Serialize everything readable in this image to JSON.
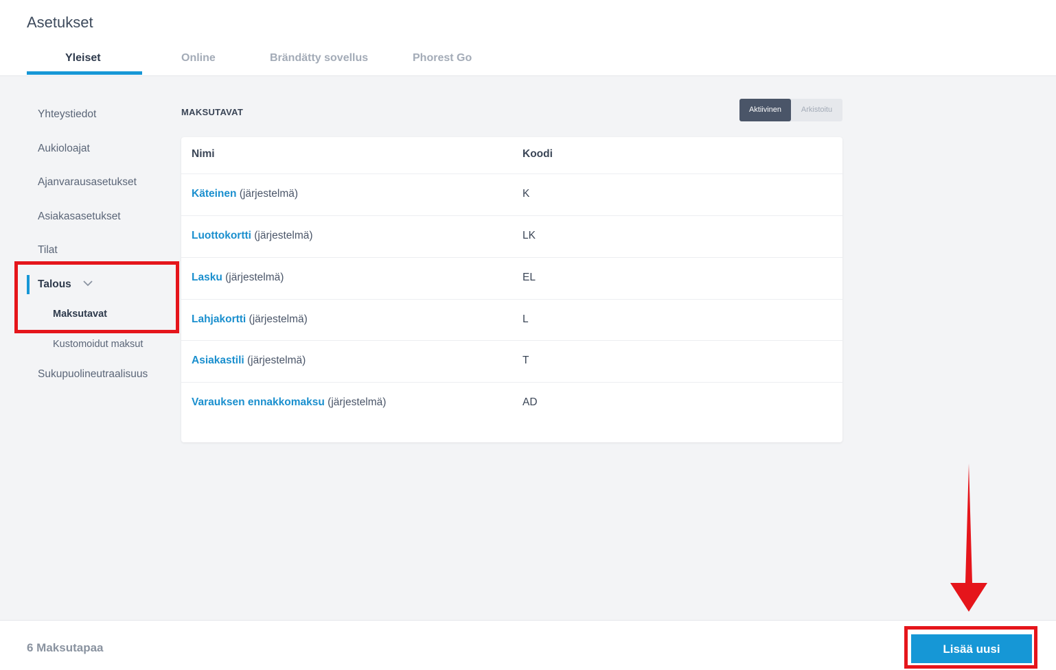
{
  "header": {
    "title": "Asetukset",
    "tabs": [
      {
        "label": "Yleiset",
        "active": true
      },
      {
        "label": "Online"
      },
      {
        "label": "Brändätty sovellus"
      },
      {
        "label": "Phorest Go"
      }
    ]
  },
  "sidebar": {
    "items": [
      {
        "label": "Yhteystiedot"
      },
      {
        "label": "Aukioloajat"
      },
      {
        "label": "Ajanvarausasetukset"
      },
      {
        "label": "Asiakasasetukset"
      },
      {
        "label": "Tilat"
      },
      {
        "label": "Talous",
        "expanded": true,
        "icon": "chevron-down-icon"
      },
      {
        "label": "Sukupuolineutraalisuus"
      }
    ],
    "subitems": [
      {
        "label": "Maksutavat",
        "active": true
      },
      {
        "label": "Kustomoidut maksut"
      }
    ]
  },
  "main": {
    "section_title": "MAKSUTAVAT",
    "filter": {
      "active_label": "Aktiivinen",
      "archived_label": "Arkistoitu",
      "selected": "Aktiivinen"
    },
    "table": {
      "columns": [
        "Nimi",
        "Koodi"
      ],
      "rows": [
        {
          "name": "Käteinen",
          "suffix": " (järjestelmä)",
          "code": "K"
        },
        {
          "name": "Luottokortti",
          "suffix": " (järjestelmä)",
          "code": "LK"
        },
        {
          "name": "Lasku",
          "suffix": " (järjestelmä)",
          "code": "EL"
        },
        {
          "name": "Lahjakortti",
          "suffix": " (järjestelmä)",
          "code": "L"
        },
        {
          "name": "Asiakastili",
          "suffix": " (järjestelmä)",
          "code": "T"
        },
        {
          "name": "Varauksen ennakkomaksu",
          "suffix": " (järjestelmä)",
          "code": "AD"
        }
      ]
    }
  },
  "footer": {
    "count_label": "6 Maksutapaa",
    "add_button": "Lisää uusi"
  },
  "colors": {
    "accent": "#1697d6",
    "annotation": "#e5151b"
  }
}
